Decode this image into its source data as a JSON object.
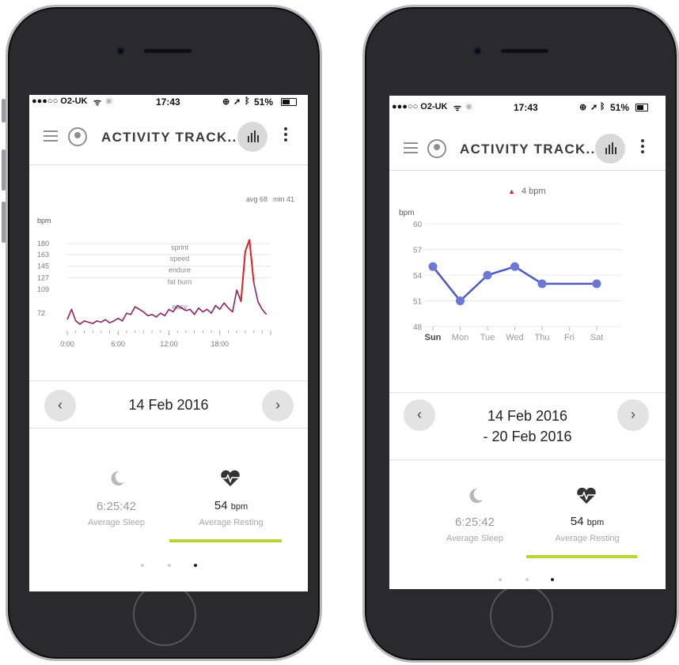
{
  "status": {
    "carrier": "●●●○○ O2-UK",
    "time": "17:43",
    "battery": "51%",
    "icons_left": [
      "wifi-icon",
      "loading-icon"
    ],
    "icons_right": [
      "lock-rotation-icon",
      "location-arrow-icon",
      "bluetooth-icon"
    ]
  },
  "appbar": {
    "title": "ACTIVITY TRACK..."
  },
  "left": {
    "summary": {
      "avg": "avg 68",
      "min": "min 41"
    },
    "ylabel": "bpm",
    "zones": [
      "sprint",
      "speed",
      "endure",
      "fat burn",
      "easy"
    ],
    "yticks": [
      "180",
      "163",
      "145",
      "127",
      "109",
      "72"
    ],
    "xticks": [
      "0:00",
      "6:00",
      "12:00",
      "18:00"
    ],
    "date": "14 Feb 2016",
    "sleep": {
      "value": "6:25:42",
      "label": "Average Sleep"
    },
    "resting": {
      "value": "54",
      "unit": "bpm",
      "label": "Average Resting"
    },
    "chart_data": {
      "type": "line",
      "title": "",
      "ylabel": "bpm",
      "xlabel": "",
      "x": [
        0,
        0.5,
        1,
        1.5,
        2,
        2.5,
        3,
        3.5,
        4,
        4.5,
        5,
        5.5,
        6,
        6.5,
        7,
        7.5,
        8,
        8.5,
        9,
        9.5,
        10,
        10.5,
        11,
        11.5,
        12,
        12.5,
        13,
        13.5,
        14,
        14.5,
        15,
        15.5,
        16,
        16.5,
        17,
        17.5,
        18,
        18.5,
        19,
        19.5,
        20,
        20.5,
        21,
        21.5,
        22,
        22.5,
        23,
        23.5
      ],
      "y": [
        62,
        78,
        60,
        55,
        60,
        58,
        56,
        60,
        58,
        62,
        57,
        60,
        64,
        60,
        72,
        70,
        82,
        78,
        74,
        68,
        70,
        66,
        72,
        68,
        78,
        74,
        84,
        80,
        76,
        78,
        70,
        80,
        74,
        78,
        72,
        84,
        78,
        88,
        80,
        74,
        108,
        90,
        168,
        186,
        120,
        90,
        78,
        70
      ],
      "xticks": [
        "0:00",
        "6:00",
        "12:00",
        "18:00"
      ],
      "yticks": [
        72,
        109,
        127,
        145,
        163,
        180
      ],
      "ylim": [
        50,
        190
      ],
      "zones": [
        "sprint",
        "speed",
        "endure",
        "fat burn",
        "easy"
      ],
      "summary": {
        "avg": 68,
        "min": 41
      }
    }
  },
  "right": {
    "delta": "4 bpm",
    "ylabel": "bpm",
    "date_line1": "14 Feb 2016",
    "date_line2": "- 20 Feb 2016",
    "sleep": {
      "value": "6:25:42",
      "label": "Average Sleep"
    },
    "resting": {
      "value": "54",
      "unit": "bpm",
      "label": "Average Resting"
    },
    "chart_data": {
      "type": "line",
      "title": "",
      "ylabel": "bpm",
      "xlabel": "",
      "categories": [
        "Sun",
        "Mon",
        "Tue",
        "Wed",
        "Thu",
        "Fri",
        "Sat"
      ],
      "values": [
        55,
        51,
        54,
        55,
        53,
        null,
        53
      ],
      "yticks": [
        48,
        51,
        54,
        57,
        60
      ],
      "ylim": [
        48,
        60
      ],
      "legend": "▲ 4 bpm",
      "colors": {
        "line": "#4d58c2",
        "point": "#6c76d4",
        "delta": "#e0231c"
      }
    }
  },
  "colors": {
    "accent": "#b7d334",
    "left_line": "#8e2266",
    "left_peak": "#e0231c"
  }
}
